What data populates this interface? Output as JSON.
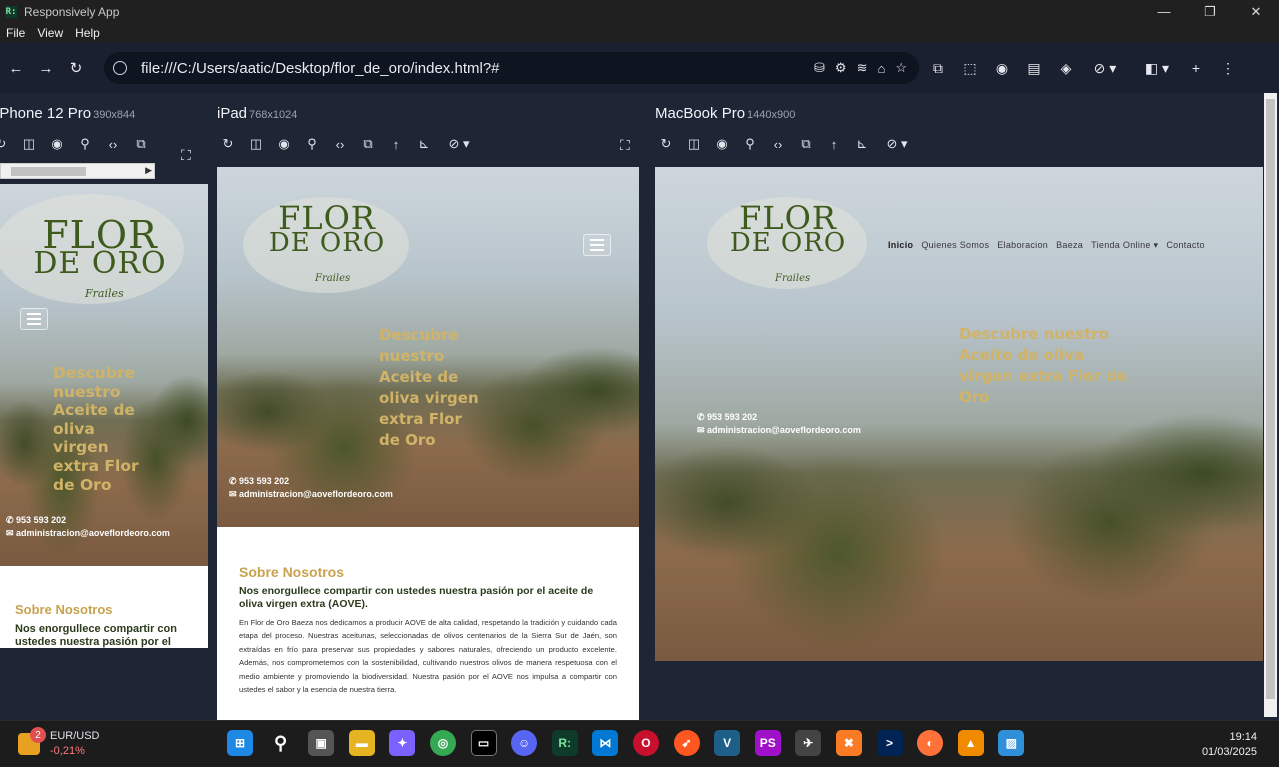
{
  "window": {
    "title": "Responsively App",
    "logo": "R:"
  },
  "menu": {
    "file": "File",
    "view": "View",
    "help": "Help"
  },
  "address": {
    "url": "file:///C:/Users/aatic/Desktop/flor_de_oro/index.html?#"
  },
  "devices": [
    {
      "name": "iPhone 12 Pro",
      "size": "390x844"
    },
    {
      "name": "iPad",
      "size": "768x1024"
    },
    {
      "name": "MacBook Pro",
      "size": "1440x900"
    }
  ],
  "site": {
    "logo_line1": "FLOR",
    "logo_line2": "DE ORO",
    "logo_sub": "Frailes",
    "nav": [
      "Inicio",
      "Quienes Somos",
      "Elaboracion",
      "Baeza",
      "Tienda Online",
      "Contacto"
    ],
    "nav_caret": "▾",
    "hero_title": "Descubre nuestro Aceite de oliva virgen extra Flor de Oro",
    "phone": "953 593 202",
    "email": "administracion@aoveflordeoro.com",
    "about_title": "Sobre Nosotros",
    "about_subtitle": "Nos enorgullece compartir con ustedes nuestra pasión por el aceite de oliva virgen extra (AOVE).",
    "about_body": "En Flor de Oro Baeza nos dedicamos a producir AOVE de alta calidad, respetando la tradición y cuidando cada etapa del proceso. Nuestras aceitunas, seleccionadas de olivos centenarios de la Sierra Sur de Jaén, son extraídas en frío para preservar sus propiedades y sabores naturales, ofreciendo un producto excelente. Además, nos comprometemos con la sostenibilidad, cultivando nuestros olivos de manera respetuosa con el medio ambiente y promoviendo la biodiversidad. Nuestra pasión por el AOVE nos impulsa a compartir con ustedes el sabor y la esencia de nuestra tierra.",
    "phone_about_subtitle": "Nos enorgullece compartir con ustedes nuestra pasión por el"
  },
  "taskbar": {
    "ticker_name": "EUR/USD",
    "ticker_value": "-0,21%",
    "badge": "2",
    "time": "19:14",
    "date": "01/03/2025"
  },
  "colors": {
    "accent_gold": "#d1b368",
    "logo_green": "#3e5a1d",
    "bg": "#1e2535"
  }
}
